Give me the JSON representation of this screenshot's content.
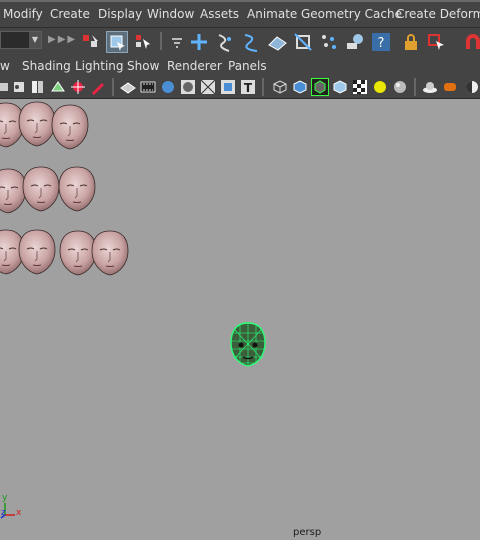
{
  "menubar": {
    "items": [
      "Modify",
      "Create",
      "Display",
      "Window",
      "Assets",
      "Animate",
      "Geometry Cache",
      "Create Deformers"
    ]
  },
  "panel_menu": {
    "items": [
      "w",
      "Shading",
      "Lighting",
      "Show",
      "Renderer",
      "Panels"
    ]
  },
  "viewport": {
    "camera_label": "persp",
    "wireframe_color": "#2aff7a",
    "axis_labels": {
      "x": "x",
      "y": "y",
      "z": "z"
    }
  },
  "colors": {
    "ui_background": "#444444",
    "viewport_background": "#a0a0a0",
    "face_skin": "#c9a3a3"
  }
}
